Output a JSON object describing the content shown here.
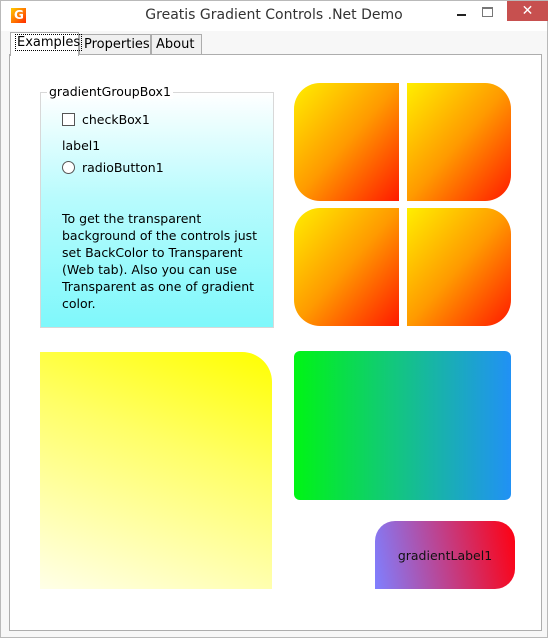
{
  "window": {
    "title": "Greatis Gradient Controls .Net Demo",
    "app_icon_glyph": "G",
    "minimize_icon": "minimize-icon",
    "maximize_icon": "maximize-icon",
    "close_glyph": "✕"
  },
  "tabs": [
    {
      "label": "Examples",
      "active": true
    },
    {
      "label": "Properties",
      "active": false
    },
    {
      "label": "About",
      "active": false
    }
  ],
  "groupbox": {
    "title": "gradientGroupBox1",
    "checkbox_label": "checkBox1",
    "checkbox_checked": false,
    "label": "label1",
    "radio_label": "radioButton1",
    "radio_checked": false,
    "text": "To get the transparent background of the controls just set BackColor to Transparent (Web tab). Also you can use Transparent as one of gradient color."
  },
  "gradient_label": {
    "text": "gradientLabel1"
  },
  "colors": {
    "close_button": "#c7504f",
    "groupbox_gradient": [
      "#ffffff",
      "#7ff8fb"
    ],
    "clover_gradient": [
      "#ffee00",
      "#ff1a00"
    ],
    "yellow_panel_gradient": [
      "#ffff00",
      "#ffffe8"
    ],
    "green_panel_gradient": [
      "#00f514",
      "#2191f5"
    ],
    "label_gradient": [
      "#7f7fff",
      "#ff0010"
    ]
  }
}
